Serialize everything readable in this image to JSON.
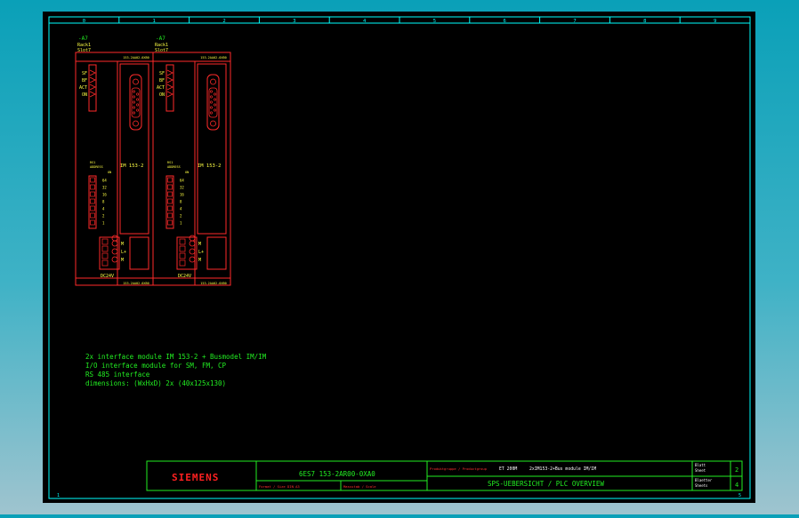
{
  "grid_columns": [
    "0",
    "1",
    "2",
    "3",
    "4",
    "5",
    "6",
    "7",
    "8",
    "9"
  ],
  "row_labels": {
    "bottom_left": "1",
    "bottom_right": "5"
  },
  "modules": [
    {
      "tag": "-A7",
      "rack": "Rack1",
      "slot": "Slot7",
      "order_top": "153-2AA02-0XB0",
      "leds": [
        "SF",
        "BF",
        "ACT",
        "ON"
      ],
      "name": "IM 153-2",
      "small_label_1": "RS1",
      "small_label_2": "ADDRESS",
      "small_label_3": "ON",
      "switch_labels": [
        "64",
        "32",
        "16",
        "8",
        "4",
        "2",
        "1"
      ],
      "terminals": [
        "M",
        "L+",
        "M"
      ],
      "supply": "DC24V",
      "order_bottom": "153-2AA02-0XB0"
    },
    {
      "tag": "-A7",
      "rack": "Rack1",
      "slot": "Slot7",
      "order_top": "153-2AA02-0XB0",
      "leds": [
        "SF",
        "BF",
        "ACT",
        "ON"
      ],
      "name": "IM 153-2",
      "small_label_1": "RS1",
      "small_label_2": "ADDRESS",
      "small_label_3": "ON",
      "switch_labels": [
        "64",
        "32",
        "16",
        "8",
        "4",
        "2",
        "1"
      ],
      "terminals": [
        "M",
        "L+",
        "M"
      ],
      "supply": "DC24V",
      "order_bottom": "153-2AA02-0XB0"
    }
  ],
  "notes": [
    "2x interface module IM 153-2 + Busmodel IM/IM",
    "I/O interface module for SM, FM, CP",
    "RS 485 interface",
    "dimensions: (WxHxD) 2x  (40x125x130)"
  ],
  "title_block": {
    "brand": "SIEMENS",
    "part_number": "6ES7 153-2AR00-0XA0",
    "label_format": "Format / Size DIN A3",
    "label_scale": "Massstab / Scale",
    "label_product": "Produktgruppe / Productgroup",
    "product_group": "ET 200M",
    "description": "2xIM153-2+Bus module IM/IM",
    "main_title": "SPS-UEBERSICHT / PLC OVERVIEW",
    "label_sheet": "Blatt",
    "label_sheet_en": "Sheet",
    "sheet": "2",
    "label_sheets": "Blaetter",
    "label_sheets_en": "Sheets",
    "sheets": "4"
  },
  "colors": {
    "frame": "#00ffff",
    "module": "#ff2a2a",
    "text_green": "#22ee22",
    "label_yellow": "#ffff44",
    "brand_red": "#ff2020"
  }
}
